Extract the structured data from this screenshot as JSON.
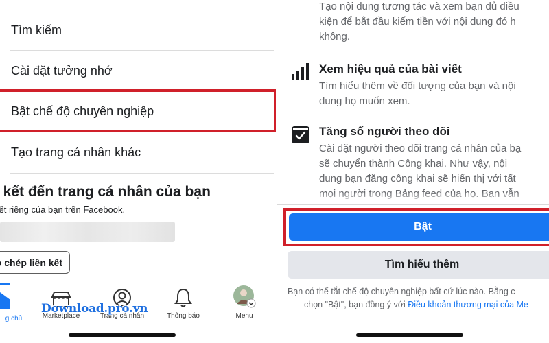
{
  "left": {
    "menu": [
      {
        "label": "Tìm kiếm"
      },
      {
        "label": "Cài đặt tưởng nhớ"
      },
      {
        "label": "Bật chế độ chuyên nghiệp"
      },
      {
        "label": "Tạo trang cá nhân khác"
      }
    ],
    "link_section": {
      "title": "n kết đến trang cá nhân của bạn",
      "subtitle": "kết riêng của bạn trên Facebook.",
      "copy_button": "o chép liên kết"
    },
    "tabbar": {
      "tabs": [
        {
          "label": "g chủ",
          "icon": "home-icon",
          "active": true
        },
        {
          "label": "Marketplace",
          "icon": "marketplace-icon"
        },
        {
          "label": "Trang cá nhân",
          "icon": "profile-icon"
        },
        {
          "label": "Thông báo",
          "icon": "bell-icon"
        },
        {
          "label": "Menu",
          "icon": "avatar-icon"
        }
      ]
    },
    "watermark": "Download.pro.vn"
  },
  "right": {
    "top_desc": [
      "Tạo nội dung tương tác và xem bạn đủ điều",
      "kiện để bắt đầu kiếm tiền với nội dung đó h",
      "không."
    ],
    "features": [
      {
        "icon": "bar-chart-icon",
        "title": "Xem hiệu quả của bài viết",
        "desc": [
          "Tìm hiểu thêm về đối tượng của bạn và nội",
          "dung họ muốn xem."
        ]
      },
      {
        "icon": "follower-inbox-icon",
        "title": "Tăng số người theo dõi",
        "desc": [
          "Cài đặt người theo dõi trang cá nhân của bạ",
          "sẽ chuyển thành Công khai. Như vậy, nội",
          "dung bạn đăng công khai sẽ hiển thị với tất",
          "mọi người trong Bảng feed của họ. Bạn vẫn"
        ]
      }
    ],
    "primary_button": "Bật",
    "secondary_button": "Tìm hiểu thêm",
    "footer": {
      "line1": "Bạn có thể tắt chế độ chuyên nghiệp bất cứ lúc nào. Bằng c",
      "line2_prefix": "chọn \"Bật\", bạn đồng ý với ",
      "line2_link": "Điều khoản thương mại của Me"
    }
  },
  "colors": {
    "accent": "#1877f2",
    "highlight_border": "#d0202a",
    "secondary_button_bg": "#e4e6eb",
    "muted_text": "#65676b",
    "watermark": "#1e6fe0"
  }
}
